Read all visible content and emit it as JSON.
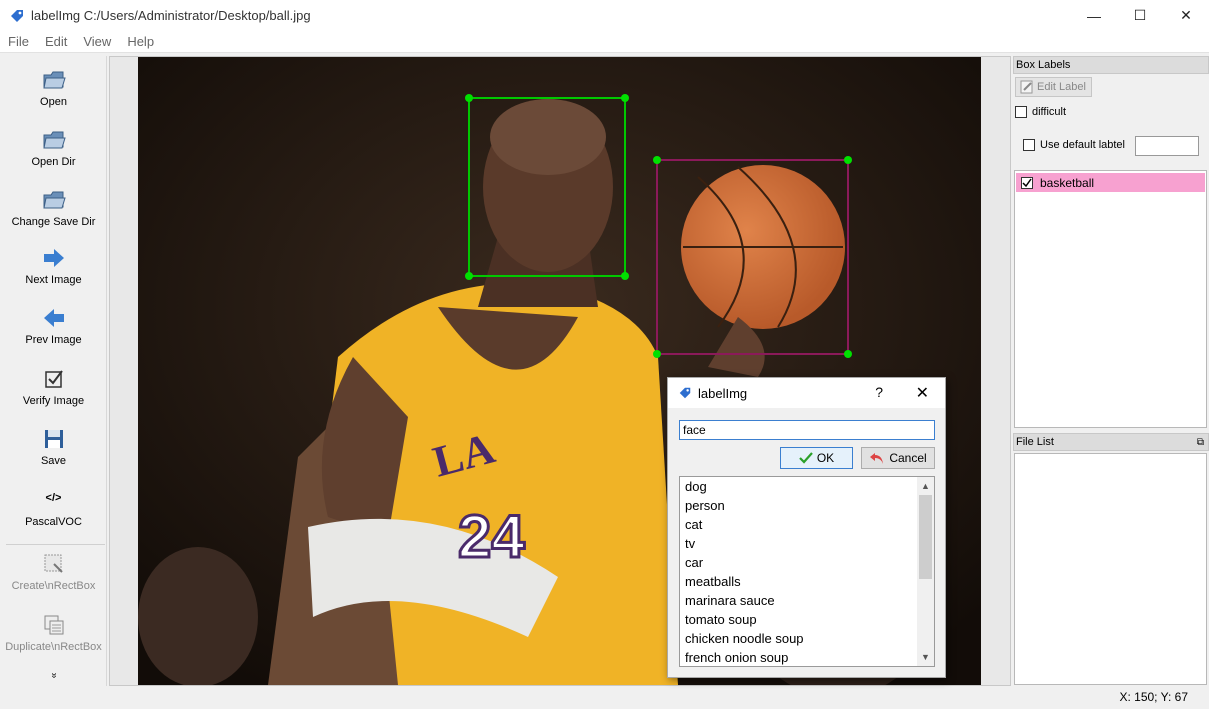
{
  "window": {
    "title": "labelImg C:/Users/Administrator/Desktop/ball.jpg",
    "minimize": "—",
    "maximize": "☐",
    "close": "✕"
  },
  "menu": [
    "File",
    "Edit",
    "View",
    "Help"
  ],
  "toolbar": {
    "open": "Open",
    "open_dir": "Open Dir",
    "change_save_dir": "Change Save Dir",
    "next_image": "Next Image",
    "prev_image": "Prev Image",
    "verify_image": "Verify Image",
    "save": "Save",
    "format_symbol": "</>",
    "format": "PascalVOC",
    "create_rect_box": "Create\\nRectBox",
    "duplicate_rect_box": "Duplicate\\nRectBox",
    "more": "»"
  },
  "box_labels": {
    "title": "Box Labels",
    "edit_label": "Edit Label",
    "difficult": "difficult",
    "use_default_label": "Use default labtel",
    "default_label_value": "",
    "items": [
      {
        "label": "basketball",
        "checked": true,
        "color": "#f7a1d0"
      }
    ]
  },
  "file_list": {
    "title": "File List",
    "items": []
  },
  "status": {
    "coords": "X: 150; Y: 67"
  },
  "annotations": [
    {
      "label": "face",
      "color": "#00c800"
    },
    {
      "label": "basketball",
      "color": "#8b1a5a"
    }
  ],
  "dialog": {
    "title": "labelImg",
    "help": "?",
    "close": "✕",
    "input_value": "face",
    "ok": "OK",
    "cancel": "Cancel",
    "options": [
      "dog",
      "person",
      "cat",
      "tv",
      "car",
      "meatballs",
      "marinara sauce",
      "tomato soup",
      "chicken noodle soup",
      "french onion soup"
    ]
  }
}
